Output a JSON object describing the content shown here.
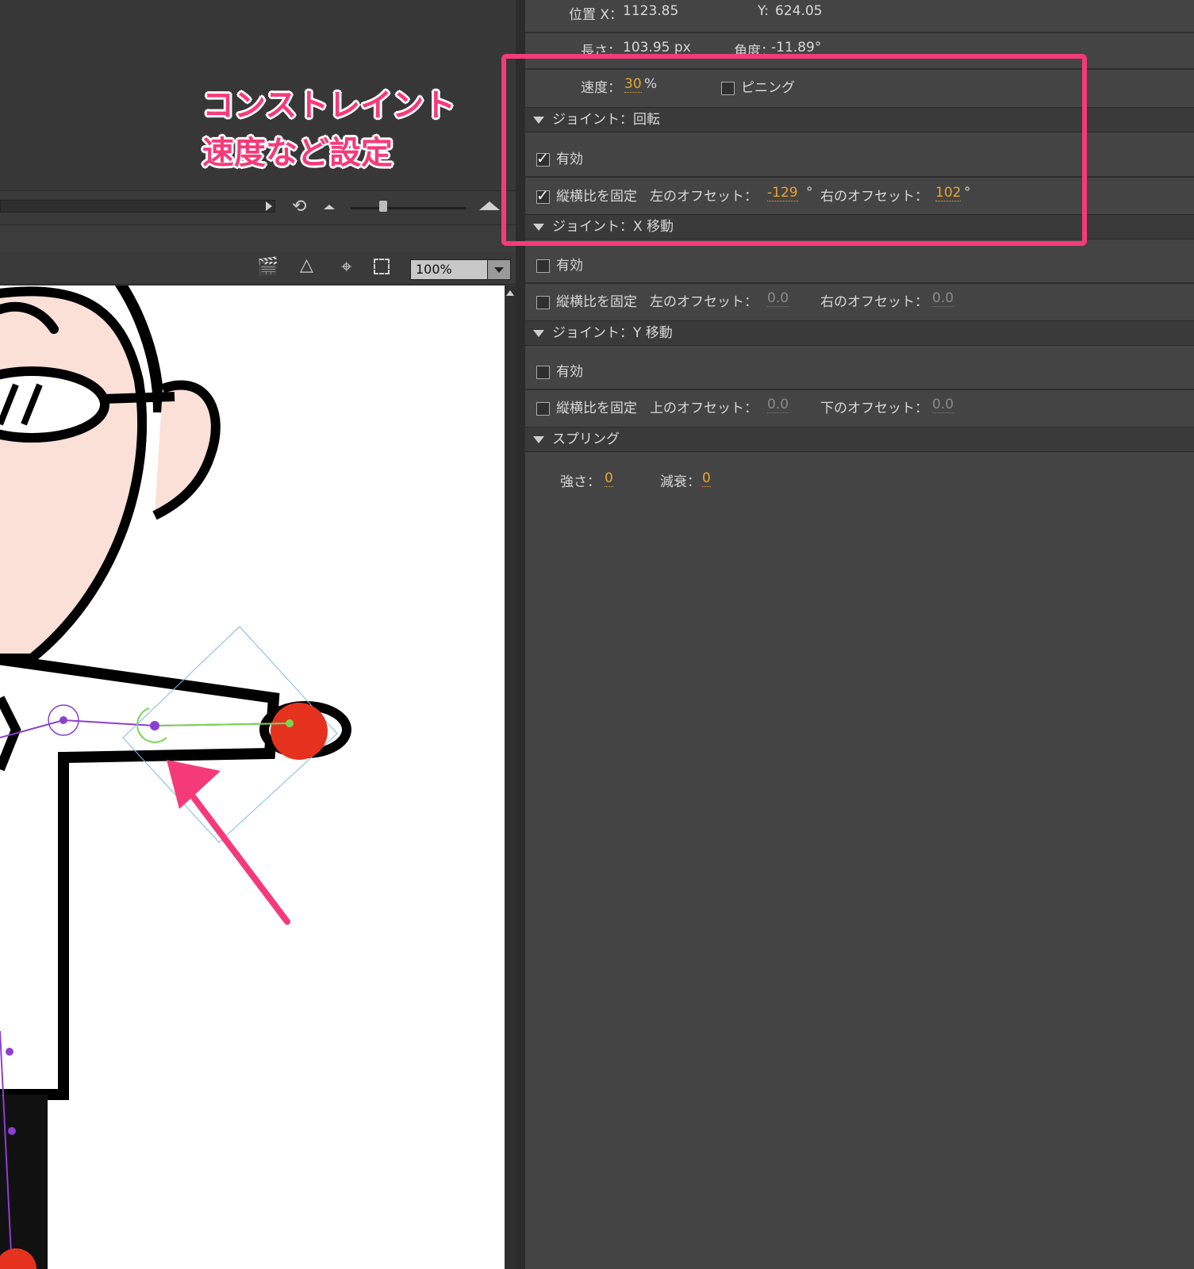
{
  "panel": {
    "position_x_label": "位置 X：",
    "position_x_value": "1123.85",
    "position_y_label": "Y:",
    "position_y_value": "624.05",
    "length_label": "長さ：",
    "length_value": "103.95 px",
    "angle_label": "角度：",
    "angle_value": "-11.89°",
    "speed_label": "速度：",
    "speed_value": "30",
    "speed_unit": "%",
    "pinning_label": "ピニング",
    "sections": {
      "rotation": "ジョイント：回転",
      "x_move": "ジョイント：X 移動",
      "y_move": "ジョイント：Y 移動",
      "spring": "スプリング"
    },
    "enable_label": "有効",
    "constrain_label": "縦横比を固定",
    "left_offset_label": "左のオフセット：",
    "right_offset_label": "右のオフセット：",
    "top_offset_label": "上のオフセット：",
    "bottom_offset_label": "下のオフセット：",
    "rotation_left_value": "-129",
    "rotation_right_value": "102",
    "degree": "°",
    "x_left_value": "0.0",
    "x_right_value": "0.0",
    "y_top_value": "0.0",
    "y_bottom_value": "0.0",
    "strength_label": "強さ：",
    "strength_value": "0",
    "damping_label": "減衰：",
    "damping_value": "0"
  },
  "stage": {
    "zoom_value": "100%"
  },
  "annotation": {
    "line1": "コンストレイント",
    "line2": "速度など設定"
  },
  "colors": {
    "highlight": "#f53a7a",
    "value_accent": "#e8a531",
    "bone": "#8a3fd1",
    "joint_active": "#7ad651"
  },
  "checkboxes": {
    "rotation_enabled": true,
    "rotation_constrain": true,
    "pinning": false,
    "x_enabled": false,
    "x_constrain": false,
    "y_enabled": false,
    "y_constrain": false
  }
}
